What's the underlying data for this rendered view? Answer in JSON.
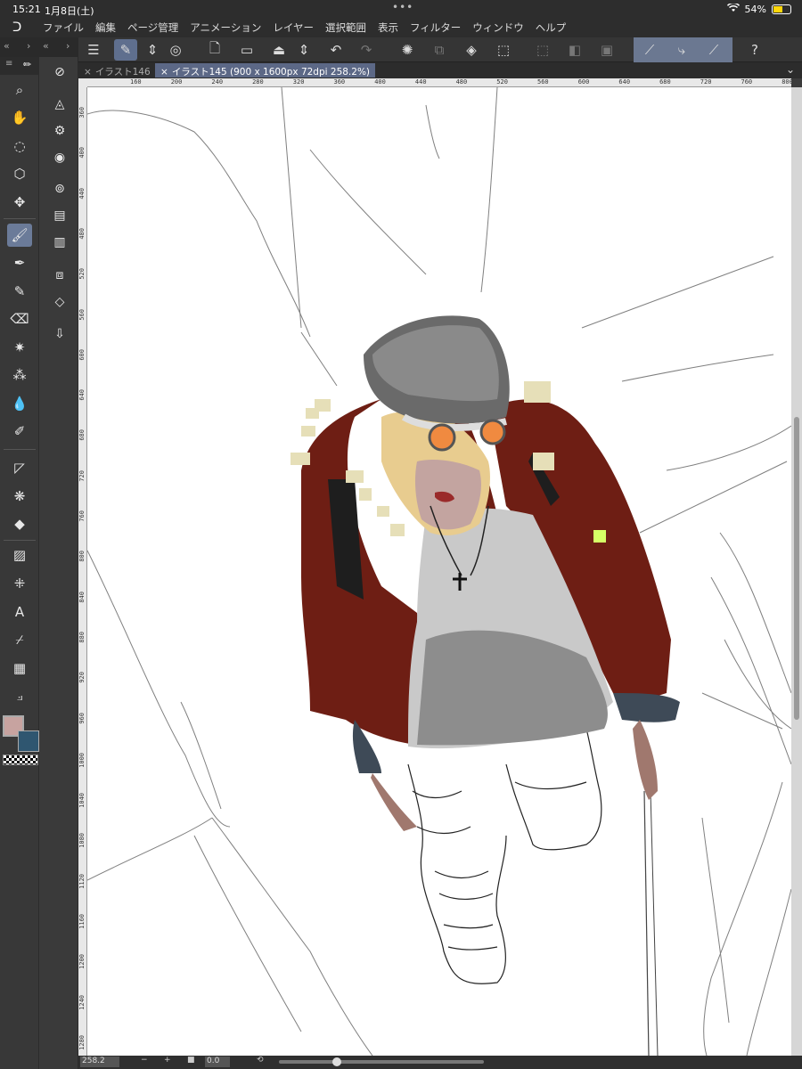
{
  "status": {
    "time": "15:21",
    "date": "1月8日(土)",
    "battery": "54%",
    "battery_level": 0.54
  },
  "menu": [
    "ファイル",
    "編集",
    "ページ管理",
    "アニメーション",
    "レイヤー",
    "選択範囲",
    "表示",
    "フィルター",
    "ウィンドウ",
    "ヘルプ"
  ],
  "tabs": [
    {
      "label": "イラスト146"
    },
    {
      "label": "イラスト145 (900 x 1600px 72dpi 258.2%)"
    }
  ],
  "ruler": {
    "h_ticks": [
      "160",
      "200",
      "240",
      "280",
      "320",
      "360",
      "400",
      "440",
      "480",
      "520",
      "560",
      "600",
      "640",
      "680",
      "720",
      "760",
      "800"
    ],
    "v_ticks": [
      "360",
      "400",
      "440",
      "480",
      "520",
      "560",
      "600",
      "640",
      "680",
      "720",
      "760",
      "800",
      "840",
      "880",
      "920",
      "960",
      "1000",
      "1040",
      "1080",
      "1120",
      "1160",
      "1200",
      "1240",
      "1280"
    ]
  },
  "bottom": {
    "zoom": "258.2",
    "rotation": "0.0"
  },
  "colors": {
    "main": "#c7a3a0",
    "sub": "#2f5670"
  }
}
